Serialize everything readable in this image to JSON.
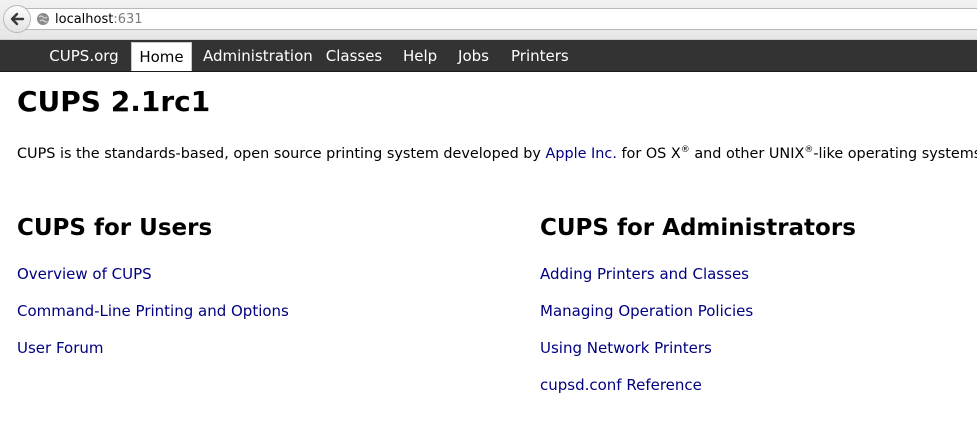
{
  "browser": {
    "url_host": "localhost",
    "url_port": ":631"
  },
  "nav": {
    "items": [
      {
        "label": "CUPS.org"
      },
      {
        "label": "Home"
      },
      {
        "label": "Administration"
      },
      {
        "label": "Classes"
      },
      {
        "label": "Help"
      },
      {
        "label": "Jobs"
      },
      {
        "label": "Printers"
      }
    ]
  },
  "main": {
    "title": "CUPS 2.1rc1",
    "intro": {
      "text_before": "CUPS is the standards-based, open source printing system developed by ",
      "apple_link": "Apple Inc.",
      "text_middle_1": " for OS X",
      "reg_mark": "®",
      "text_middle_2": " and other UNIX",
      "text_after": "-like operating systems."
    },
    "users_section": {
      "heading": "CUPS for Users",
      "links": [
        "Overview of CUPS",
        "Command-Line Printing and Options",
        "User Forum"
      ]
    },
    "admin_section": {
      "heading": "CUPS for Administrators",
      "links": [
        "Adding Printers and Classes",
        "Managing Operation Policies",
        "Using Network Printers",
        "cupsd.conf Reference"
      ]
    }
  },
  "colors": {
    "navbar_bg": "#333333",
    "link": "#000080"
  }
}
